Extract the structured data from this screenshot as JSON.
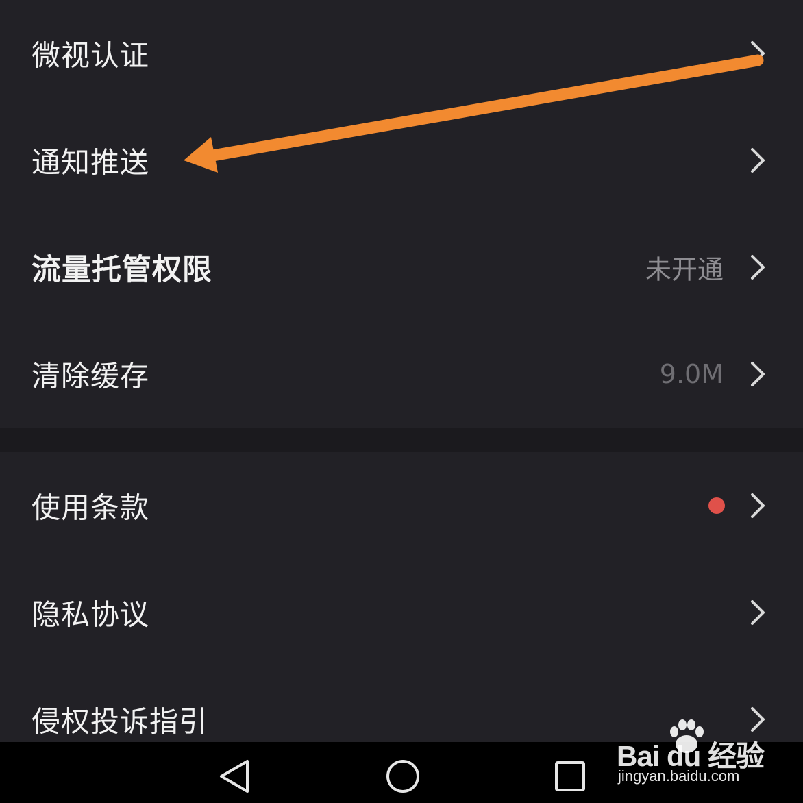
{
  "settings": {
    "section1": [
      {
        "label": "微视认证"
      },
      {
        "label": "通知推送"
      },
      {
        "label": "流量托管权限",
        "value": "未开通"
      },
      {
        "label": "清除缓存",
        "value": "9.0M"
      }
    ],
    "section2": [
      {
        "label": "使用条款",
        "badge": "red-dot"
      },
      {
        "label": "隐私协议"
      },
      {
        "label": "侵权投诉指引"
      }
    ]
  },
  "annotation": {
    "arrow_color": "#f28a30",
    "points_to": "通知推送"
  },
  "navbar": {
    "back_icon": "triangle-back-icon",
    "home_icon": "circle-home-icon",
    "recent_icon": "square-recent-icon"
  },
  "watermark": {
    "brand": "Bai du 经验",
    "url": "jingyan.baidu.com"
  },
  "colors": {
    "background": "#222126",
    "text": "#f2f2f2",
    "secondary_text": "#8e8d92",
    "badge": "#e0514a",
    "chevron": "#d9d9d9"
  }
}
